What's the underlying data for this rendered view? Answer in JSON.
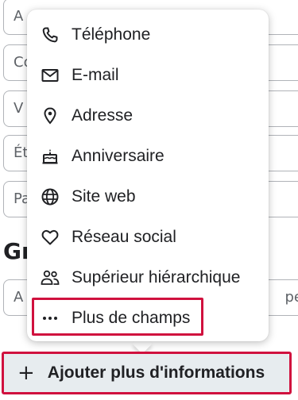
{
  "background": {
    "fields": [
      {
        "visible_text": "A"
      },
      {
        "visible_text": "Co"
      },
      {
        "visible_text": "V"
      },
      {
        "visible_text": "Ét"
      },
      {
        "visible_text": "Pa"
      }
    ],
    "section_heading_partial": "Gr",
    "group_field_left": "A",
    "group_field_right": "pe"
  },
  "menu": {
    "items": [
      {
        "label": "Téléphone",
        "icon": "phone-icon"
      },
      {
        "label": "E-mail",
        "icon": "mail-icon"
      },
      {
        "label": "Adresse",
        "icon": "location-pin-icon"
      },
      {
        "label": "Anniversaire",
        "icon": "cake-icon"
      },
      {
        "label": "Site web",
        "icon": "globe-icon"
      },
      {
        "label": "Réseau social",
        "icon": "heart-icon"
      },
      {
        "label": "Supérieur hiérarchique",
        "icon": "people-icon"
      },
      {
        "label": "Plus de champs",
        "icon": "more-horizontal-icon"
      }
    ]
  },
  "add_button": {
    "plus": "+",
    "label": "Ajouter plus d'informations"
  },
  "colors": {
    "highlight": "#d0113e",
    "button_bg": "#e7ecef"
  }
}
